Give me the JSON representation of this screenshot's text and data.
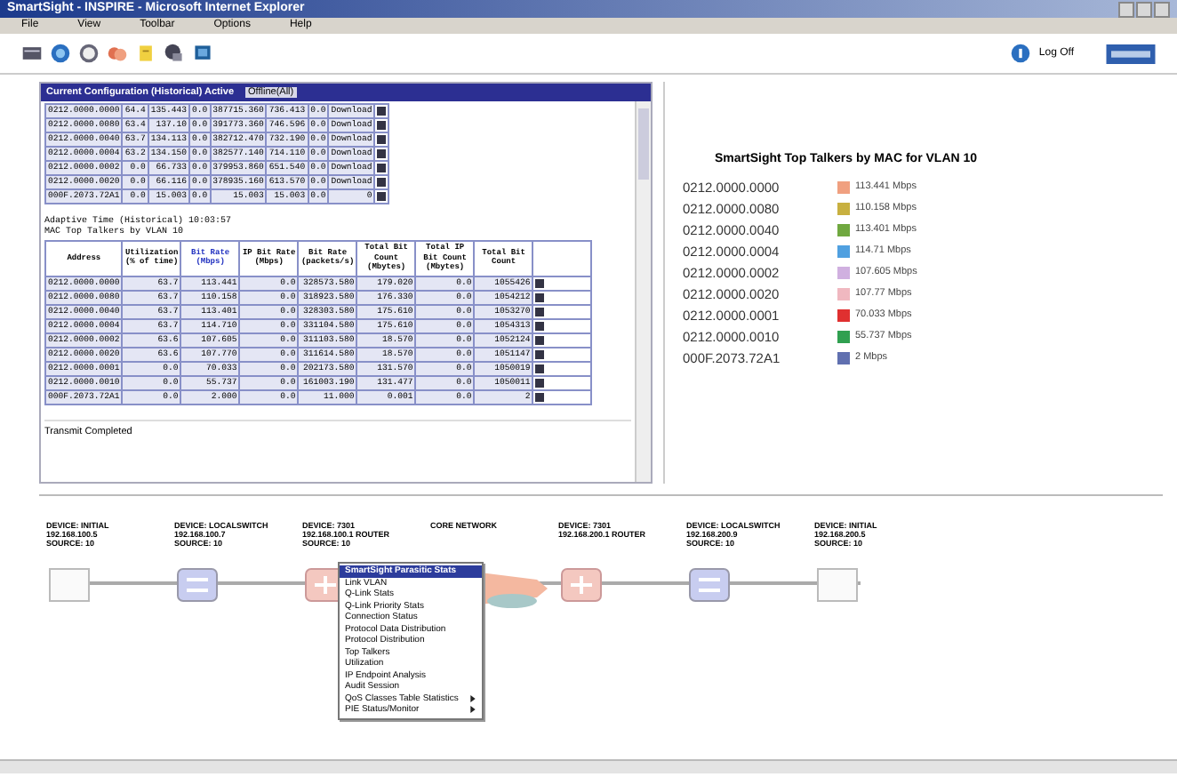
{
  "window": {
    "title": "SmartSight - INSPIRE - Microsoft Internet Explorer"
  },
  "menu": [
    "File",
    "View",
    "Toolbar",
    "Options",
    "Help"
  ],
  "toolbar": {
    "logoff": "Log Off"
  },
  "top_table": {
    "title": "Current Configuration (Historical) Active",
    "tab": "Offline(All)",
    "rows": [
      [
        "0212.0000.0000",
        "64.4",
        "135.443",
        "0.0",
        "387715.360",
        "736.413",
        "0.0",
        "Download"
      ],
      [
        "0212.0000.0080",
        "63.4",
        "137.10",
        "0.0",
        "391773.360",
        "746.596",
        "0.0",
        "Download"
      ],
      [
        "0212.0000.0040",
        "63.7",
        "134.113",
        "0.0",
        "382712.470",
        "732.190",
        "0.0",
        "Download"
      ],
      [
        "0212.0000.0004",
        "63.2",
        "134.150",
        "0.0",
        "382577.140",
        "714.110",
        "0.0",
        "Download"
      ],
      [
        "0212.0000.0002",
        "0.0",
        "66.733",
        "0.0",
        "379953.860",
        "651.540",
        "0.0",
        "Download"
      ],
      [
        "0212.0000.0020",
        "0.0",
        "66.116",
        "0.0",
        "378935.160",
        "613.570",
        "0.0",
        "Download"
      ],
      [
        "000F.2073.72A1",
        "0.0",
        "15.003",
        "0.0",
        "15.003",
        "15.003",
        "0.0",
        "0"
      ]
    ]
  },
  "caption": [
    "Adaptive Time (Historical) 10:03:57",
    "MAC Top Talkers by VLAN 10"
  ],
  "main_table": {
    "columns": [
      "Address",
      "Utilization (% of time)",
      "Bit Rate (Mbps)",
      "IP Bit Rate (Mbps)",
      "Bit Rate (packets/s)",
      "Total Bit Count (Mbytes)",
      "Total IP Bit Count (Mbytes)",
      "Total Bit Count"
    ],
    "rows": [
      [
        "0212.0000.0000",
        "63.7",
        "113.441",
        "0.0",
        "328573.580",
        "179.020",
        "0.0",
        "1055426"
      ],
      [
        "0212.0000.0080",
        "63.7",
        "110.158",
        "0.0",
        "318923.580",
        "176.330",
        "0.0",
        "1054212"
      ],
      [
        "0212.0000.0040",
        "63.7",
        "113.401",
        "0.0",
        "328303.580",
        "175.610",
        "0.0",
        "1053270"
      ],
      [
        "0212.0000.0004",
        "63.7",
        "114.710",
        "0.0",
        "331104.580",
        "175.610",
        "0.0",
        "1054313"
      ],
      [
        "0212.0000.0002",
        "63.6",
        "107.605",
        "0.0",
        "311103.580",
        "18.570",
        "0.0",
        "1052124"
      ],
      [
        "0212.0000.0020",
        "63.6",
        "107.770",
        "0.0",
        "311614.580",
        "18.570",
        "0.0",
        "1051147"
      ],
      [
        "0212.0000.0001",
        "0.0",
        "70.033",
        "0.0",
        "202173.580",
        "131.570",
        "0.0",
        "1050019"
      ],
      [
        "0212.0000.0010",
        "0.0",
        "55.737",
        "0.0",
        "161003.190",
        "131.477",
        "0.0",
        "1050011"
      ],
      [
        "000F.2073.72A1",
        "0.0",
        "2.000",
        "0.0",
        "11.000",
        "0.001",
        "0.0",
        "2"
      ]
    ]
  },
  "status": "Transmit Completed",
  "chart": {
    "title": "SmartSight Top Talkers by MAC for VLAN 10",
    "items": [
      {
        "name": "0212.0000.0000",
        "value": "113.441 Mbps",
        "color": "#f0a080"
      },
      {
        "name": "0212.0000.0080",
        "value": "110.158 Mbps",
        "color": "#c8b040"
      },
      {
        "name": "0212.0000.0040",
        "value": "113.401 Mbps",
        "color": "#70a840"
      },
      {
        "name": "0212.0000.0004",
        "value": "114.71 Mbps",
        "color": "#50a0e0"
      },
      {
        "name": "0212.0000.0002",
        "value": "107.605 Mbps",
        "color": "#d0b0e0"
      },
      {
        "name": "0212.0000.0020",
        "value": "107.77 Mbps",
        "color": "#f0b8c0"
      },
      {
        "name": "0212.0000.0001",
        "value": "70.033 Mbps",
        "color": "#e03030"
      },
      {
        "name": "0212.0000.0010",
        "value": "55.737 Mbps",
        "color": "#30a050"
      },
      {
        "name": "000F.2073.72A1",
        "value": "2 Mbps",
        "color": "#6070b0"
      }
    ]
  },
  "path": [
    {
      "kind": "host",
      "label": [
        "DEVICE: INITIAL",
        "192.168.100.5",
        "SOURCE: 10"
      ]
    },
    {
      "kind": "switch",
      "label": [
        "DEVICE: LOCALSWITCH",
        "192.168.100.7",
        "SOURCE: 10"
      ]
    },
    {
      "kind": "router",
      "label": [
        "DEVICE: 7301",
        "192.168.100.1 ROUTER",
        "SOURCE: 10"
      ]
    },
    {
      "kind": "cloud",
      "label": [
        "CORE NETWORK"
      ]
    },
    {
      "kind": "router",
      "label": [
        "DEVICE: 7301",
        "192.168.200.1 ROUTER"
      ]
    },
    {
      "kind": "switch",
      "label": [
        "DEVICE: LOCALSWITCH",
        "192.168.200.9",
        "SOURCE: 10"
      ]
    },
    {
      "kind": "host",
      "label": [
        "DEVICE: INITIAL",
        "192.168.200.5",
        "SOURCE: 10"
      ]
    }
  ],
  "context_menu": [
    {
      "label": "SmartSight Parasitic Stats",
      "selected": true,
      "submenu": false
    },
    {
      "label": "Link VLAN",
      "selected": false,
      "submenu": false
    },
    {
      "label": "Q-Link Stats",
      "selected": false,
      "submenu": false
    },
    {
      "label": "Q-Link Priority Stats",
      "selected": false,
      "submenu": false
    },
    {
      "label": "Connection Status",
      "selected": false,
      "submenu": false
    },
    {
      "label": "Protocol Data Distribution",
      "selected": false,
      "submenu": false
    },
    {
      "label": "Protocol Distribution",
      "selected": false,
      "submenu": false
    },
    {
      "label": "Top Talkers",
      "selected": false,
      "submenu": false
    },
    {
      "label": "Utilization",
      "selected": false,
      "submenu": false
    },
    {
      "label": "IP Endpoint Analysis",
      "selected": false,
      "submenu": false
    },
    {
      "label": "Audit Session",
      "selected": false,
      "submenu": false
    },
    {
      "label": "QoS Classes Table Statistics",
      "selected": false,
      "submenu": true
    },
    {
      "label": "PIE Status/Monitor",
      "selected": false,
      "submenu": true
    }
  ]
}
